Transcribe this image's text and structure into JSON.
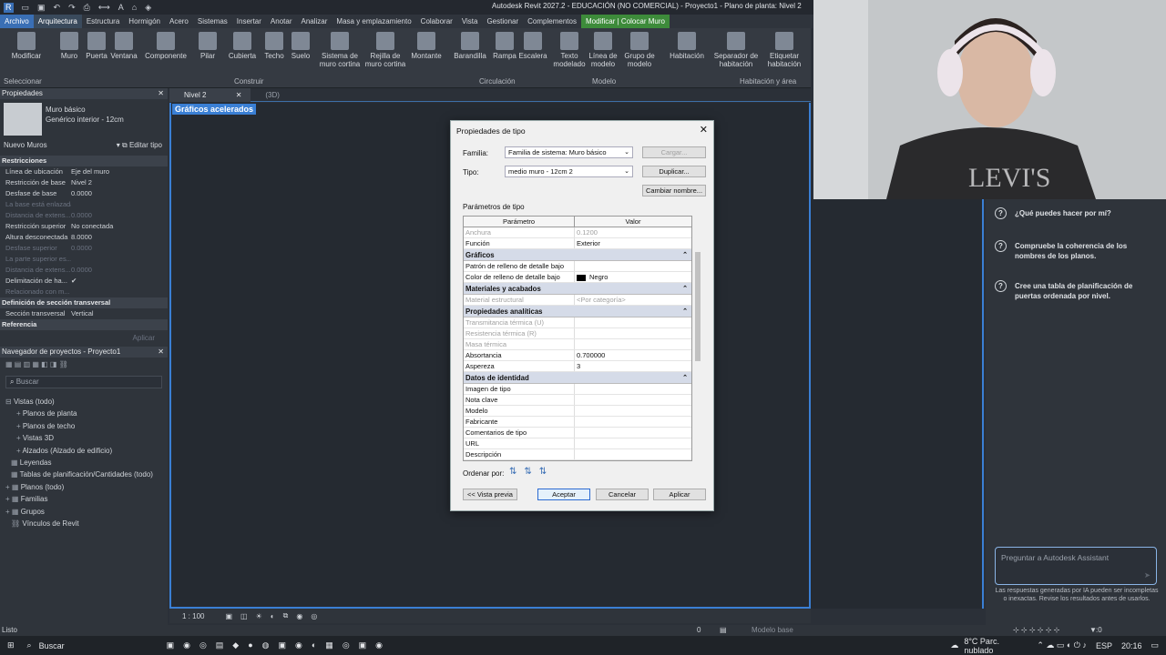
{
  "app": {
    "title": "Autodesk Revit 2027.2 - EDUCACIÓN (NO COMERCIAL) - Proyecto1 - Plano de planta: Nivel 2"
  },
  "menu": [
    "Archivo",
    "Arquitectura",
    "Estructura",
    "Hormigón",
    "Acero",
    "Sistemas",
    "Insertar",
    "Anotar",
    "Analizar",
    "Masa y emplazamiento",
    "Colaborar",
    "Vista",
    "Gestionar",
    "Complementos",
    "Modificar | Colocar Muro"
  ],
  "ribbon": {
    "buttons": [
      "Modificar",
      "Muro",
      "Puerta",
      "Ventana",
      "Componente",
      "Pilar",
      "Cubierta",
      "Techo",
      "Suelo",
      "Sistema de muro cortina",
      "Rejilla de muro cortina",
      "Montante",
      "Barandilla",
      "Rampa",
      "Escalera",
      "Texto modelado",
      "Línea de modelo",
      "Grupo de modelo",
      "Habitación",
      "Separador de habitación",
      "Etiquetar habitación"
    ],
    "groups": [
      "Seleccionar",
      "Construir",
      "Circulación",
      "Modelo",
      "Habitación y área"
    ]
  },
  "properties": {
    "title": "Propiedades",
    "type_name": "Muro básico",
    "type_sub": "Genérico interior - 12cm",
    "instance": "Nuevo Muros",
    "edit_type": "Editar tipo",
    "sections": {
      "constraints": "Restricciones",
      "cross": "Definición de sección transversal",
      "reference": "Referencia"
    },
    "rows": [
      {
        "k": "Línea de ubicación",
        "v": "Eje del muro",
        "dim": false
      },
      {
        "k": "Restricción de base",
        "v": "Nivel 2",
        "dim": false
      },
      {
        "k": "Desfase de base",
        "v": "0.0000",
        "dim": false
      },
      {
        "k": "La base está enlazada",
        "v": "",
        "dim": true
      },
      {
        "k": "Distancia de extens...",
        "v": "0.0000",
        "dim": true
      },
      {
        "k": "Restricción superior",
        "v": "No conectada",
        "dim": false
      },
      {
        "k": "Altura desconectada",
        "v": "8.0000",
        "dim": false
      },
      {
        "k": "Desfase superior",
        "v": "0.0000",
        "dim": true
      },
      {
        "k": "La parte superior es...",
        "v": "",
        "dim": true
      },
      {
        "k": "Distancia de extens...",
        "v": "0.0000",
        "dim": true
      },
      {
        "k": "Delimitación de ha...",
        "v": "✔",
        "dim": false
      },
      {
        "k": "Relacionado con m...",
        "v": "",
        "dim": true
      }
    ],
    "cross_row": {
      "k": "Sección transversal",
      "v": "Vertical"
    },
    "apply": "Aplicar"
  },
  "browser": {
    "title": "Navegador de proyectos - Proyecto1",
    "search_placeholder": "Buscar",
    "items": [
      "Vistas (todo)",
      "Planos de planta",
      "Planos de techo",
      "Vistas 3D",
      "Alzados (Alzado de edificio)",
      "Leyendas",
      "Tablas de planificación/Cantidades (todo)",
      "Planos (todo)",
      "Familias",
      "Grupos",
      "Vínculos de Revit"
    ]
  },
  "tabs": [
    "Nivel 2",
    "(3D)"
  ],
  "canvas": {
    "banner": "Gráficos acelerados"
  },
  "viewbar": {
    "scale": "1 : 100"
  },
  "dialog": {
    "title": "Propiedades de tipo",
    "family_label": "Familia:",
    "family_value": "Familia de sistema: Muro básico",
    "type_label": "Tipo:",
    "type_value": "medio muro - 12cm 2",
    "load_btn": "Cargar...",
    "dup_btn": "Duplicar...",
    "rename_btn": "Cambiar nombre...",
    "params_label": "Parámetros de tipo",
    "col_param": "Parámetro",
    "col_value": "Valor",
    "rows_top": [
      {
        "k": "Anchura",
        "v": "0.1200",
        "dim": true
      },
      {
        "k": "Función",
        "v": "Exterior",
        "dim": false
      }
    ],
    "sec_graphics": "Gráficos",
    "rows_graphics": [
      {
        "k": "Patrón de relleno de detalle bajo",
        "v": "",
        "dim": false
      },
      {
        "k": "Color de relleno de detalle bajo",
        "v": "Negro",
        "dim": false
      }
    ],
    "sec_materials": "Materiales y acabados",
    "rows_materials": [
      {
        "k": "Material estructural",
        "v": "<Por categoría>",
        "dim": true
      }
    ],
    "sec_analytic": "Propiedades analíticas",
    "rows_analytic": [
      {
        "k": "Transmitancia térmica (U)",
        "v": "",
        "dim": true
      },
      {
        "k": "Resistencia térmica (R)",
        "v": "",
        "dim": true
      },
      {
        "k": "Masa térmica",
        "v": "",
        "dim": true
      },
      {
        "k": "Absortancia",
        "v": "0.700000",
        "dim": false
      },
      {
        "k": "Aspereza",
        "v": "3",
        "dim": false
      }
    ],
    "sec_identity": "Datos de identidad",
    "rows_identity": [
      {
        "k": "Imagen de tipo",
        "v": "",
        "dim": false
      },
      {
        "k": "Nota clave",
        "v": "",
        "dim": false
      },
      {
        "k": "Modelo",
        "v": "",
        "dim": false
      },
      {
        "k": "Fabricante",
        "v": "",
        "dim": false
      },
      {
        "k": "Comentarios de tipo",
        "v": "",
        "dim": false
      },
      {
        "k": "URL",
        "v": "",
        "dim": false
      },
      {
        "k": "Descripción",
        "v": "",
        "dim": false
      }
    ],
    "sort_label": "Ordenar por:",
    "preview_btn": "<< Vista previa",
    "ok_btn": "Aceptar",
    "cancel_btn": "Cancelar",
    "apply_btn": "Aplicar"
  },
  "assistant": {
    "suggestions": [
      "¿Qué puedes hacer por mí?",
      "Compruebe la coherencia de los nombres de los planos.",
      "Cree una tabla de planificación de puertas ordenada por nivel."
    ],
    "placeholder": "Preguntar a Autodesk Assistant",
    "disclaimer": "Las respuestas generadas por IA pueden ser incompletas o inexactas. Revise los resultados antes de usarlos."
  },
  "status": {
    "text": "Listo",
    "model": "Modelo base",
    "zero1": "0",
    "zero2": ":0"
  },
  "taskbar": {
    "search": "Buscar",
    "weather": "8°C  Parc. nublado",
    "lang": "ESP",
    "time": "20:16"
  }
}
